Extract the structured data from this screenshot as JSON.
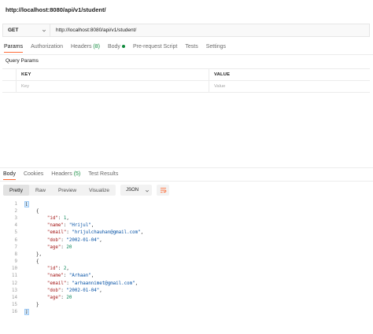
{
  "request": {
    "title": "http://localhost:8080/api/v1/student/",
    "method": "GET",
    "url": "http://localhost:8080/api/v1/student/"
  },
  "request_tabs": [
    {
      "label": "Params",
      "active": true
    },
    {
      "label": "Authorization"
    },
    {
      "label": "Headers",
      "count": "(8)"
    },
    {
      "label": "Body",
      "dot": true
    },
    {
      "label": "Pre-request Script"
    },
    {
      "label": "Tests"
    },
    {
      "label": "Settings"
    }
  ],
  "query_params": {
    "label": "Query Params",
    "headers": [
      "KEY",
      "VALUE"
    ],
    "placeholders": [
      "Key",
      "Value"
    ]
  },
  "response_tabs": [
    {
      "label": "Body",
      "active": true
    },
    {
      "label": "Cookies"
    },
    {
      "label": "Headers",
      "count": "(5)"
    },
    {
      "label": "Test Results"
    }
  ],
  "response_toolbar": {
    "views": [
      "Pretty",
      "Raw",
      "Preview",
      "Visualize"
    ],
    "active_view": "Pretty",
    "format": "JSON"
  },
  "response_body": {
    "line_numbers": [
      "1",
      "2",
      "3",
      "4",
      "5",
      "6",
      "7",
      "8",
      "9",
      "10",
      "11",
      "12",
      "13",
      "14",
      "15",
      "16"
    ],
    "students": [
      {
        "id": "1",
        "name": "\"Hrijul\"",
        "email": "\"hrijulchauhan@gmail.com\"",
        "dob": "\"2002-01-04\"",
        "age": "20"
      },
      {
        "id": "2",
        "name": "\"Arhaan\"",
        "email": "\"arhaannimet@gmail.com\"",
        "dob": "\"2002-01-04\"",
        "age": "20"
      }
    ],
    "keys": {
      "id": "\"id\"",
      "name": "\"name\"",
      "email": "\"email\"",
      "dob": "\"dob\"",
      "age": "\"age\""
    }
  },
  "colors": {
    "accent": "#ff6c37",
    "success": "#0f8a3c"
  },
  "icons": {
    "method_dropdown": "chevron-down-icon",
    "format_dropdown": "chevron-down-icon",
    "wrap": "wrap-lines-icon"
  }
}
